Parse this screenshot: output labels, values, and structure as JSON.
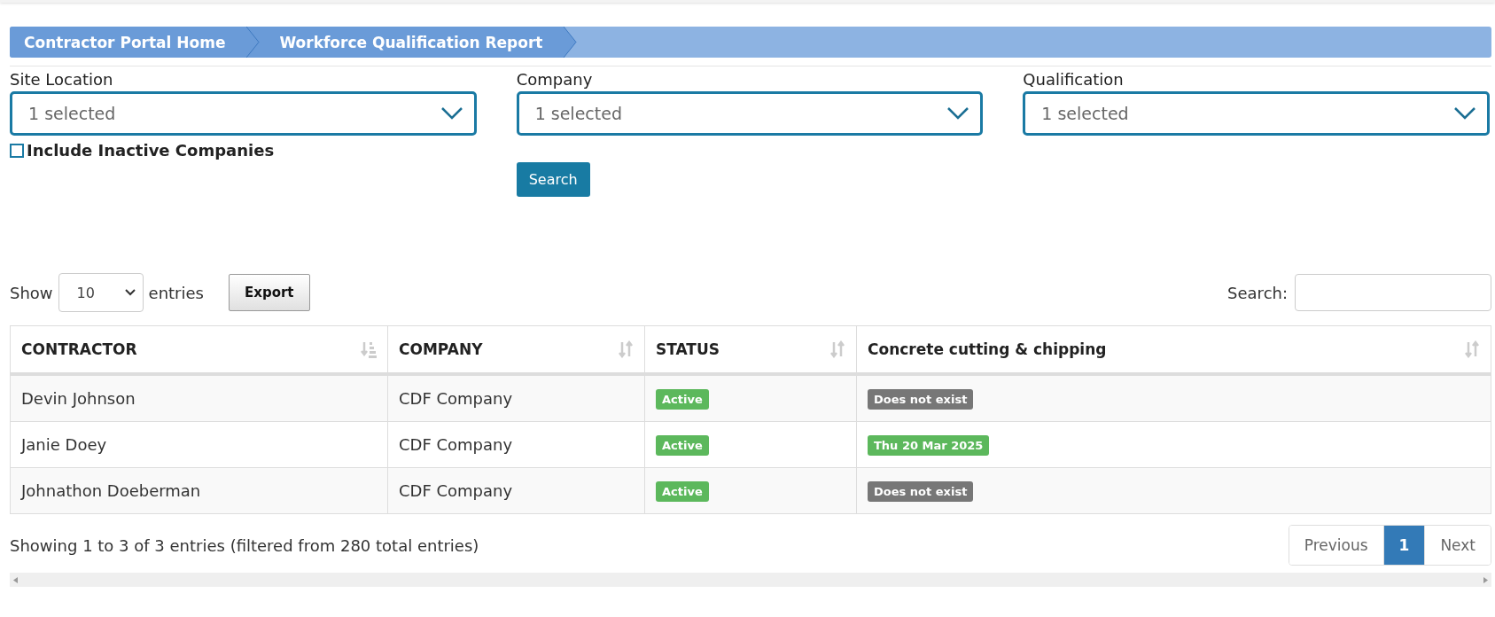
{
  "breadcrumb": [
    {
      "label": "Contractor Portal Home"
    },
    {
      "label": "Workforce Qualification Report"
    }
  ],
  "filters": [
    {
      "label": "Site Location",
      "value": "1 selected"
    },
    {
      "label": "Company",
      "value": "1 selected"
    },
    {
      "label": "Qualification",
      "value": "1 selected"
    }
  ],
  "include_inactive": {
    "label": "Include Inactive Companies",
    "checked": false
  },
  "search_button": "Search",
  "length": {
    "before": "Show",
    "value": "10",
    "after": "entries"
  },
  "export_button": "Export",
  "table_search": {
    "label": "Search:"
  },
  "table": {
    "columns": [
      {
        "label": "CONTRACTOR",
        "sorted": true
      },
      {
        "label": "COMPANY",
        "sorted": false
      },
      {
        "label": "STATUS",
        "sorted": false
      },
      {
        "label": "Concrete cutting & chipping",
        "sorted": false
      }
    ],
    "rows": [
      {
        "contractor": "Devin Johnson",
        "company": "CDF Company",
        "status": {
          "text": "Active",
          "color": "#5cb85c"
        },
        "qualification": {
          "text": "Does not exist",
          "color": "#777777"
        }
      },
      {
        "contractor": "Janie Doey",
        "company": "CDF Company",
        "status": {
          "text": "Active",
          "color": "#5cb85c"
        },
        "qualification": {
          "text": "Thu 20 Mar 2025",
          "color": "#5cb85c"
        }
      },
      {
        "contractor": "Johnathon Doeberman",
        "company": "CDF Company",
        "status": {
          "text": "Active",
          "color": "#5cb85c"
        },
        "qualification": {
          "text": "Does not exist",
          "color": "#777777"
        }
      }
    ]
  },
  "info": "Showing 1 to 3 of 3 entries (filtered from 280 total entries)",
  "pagination": [
    {
      "label": "Previous",
      "selected": false
    },
    {
      "label": "1",
      "selected": true
    },
    {
      "label": "Next",
      "selected": false
    }
  ]
}
